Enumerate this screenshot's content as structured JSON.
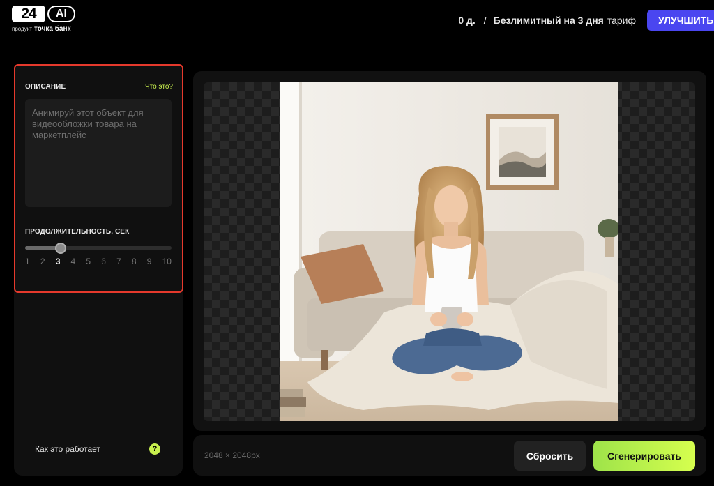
{
  "header": {
    "logo_number": "24",
    "logo_ai": "AI",
    "logo_sub_prefix": "продукт",
    "logo_sub_brand": "точка банк",
    "credits": "0 д.",
    "separator": "/",
    "plan": "Безлимитный на 3 дня",
    "tariff": "тариф",
    "upgrade_label": "УЛУЧШИТЬ"
  },
  "settings": {
    "description_label": "ОПИСАНИЕ",
    "what_is_it_link": "Что это?",
    "description_value": "",
    "description_placeholder": "Анимируй этот объект для видеообложки товара на маркетплейс",
    "duration_label": "ПРОДОЛЖИТЕЛЬНОСТЬ, СЕК",
    "duration_value": 3,
    "duration_ticks": [
      "1",
      "2",
      "3",
      "4",
      "5",
      "6",
      "7",
      "8",
      "9",
      "10"
    ],
    "selected_tick_index": 2
  },
  "help": {
    "how_it_works": "Как это работает",
    "icon": "?"
  },
  "canvas": {
    "image_size": "2048 × 2048px",
    "image_subject": "woman-on-sofa-with-mug-icon"
  },
  "actions": {
    "reset_label": "Сбросить",
    "generate_label": "Сгенерировать"
  },
  "colors": {
    "accent_blue": "#4a46f0",
    "accent_lime": "#c8f04e",
    "highlight_red": "#e5392c"
  }
}
